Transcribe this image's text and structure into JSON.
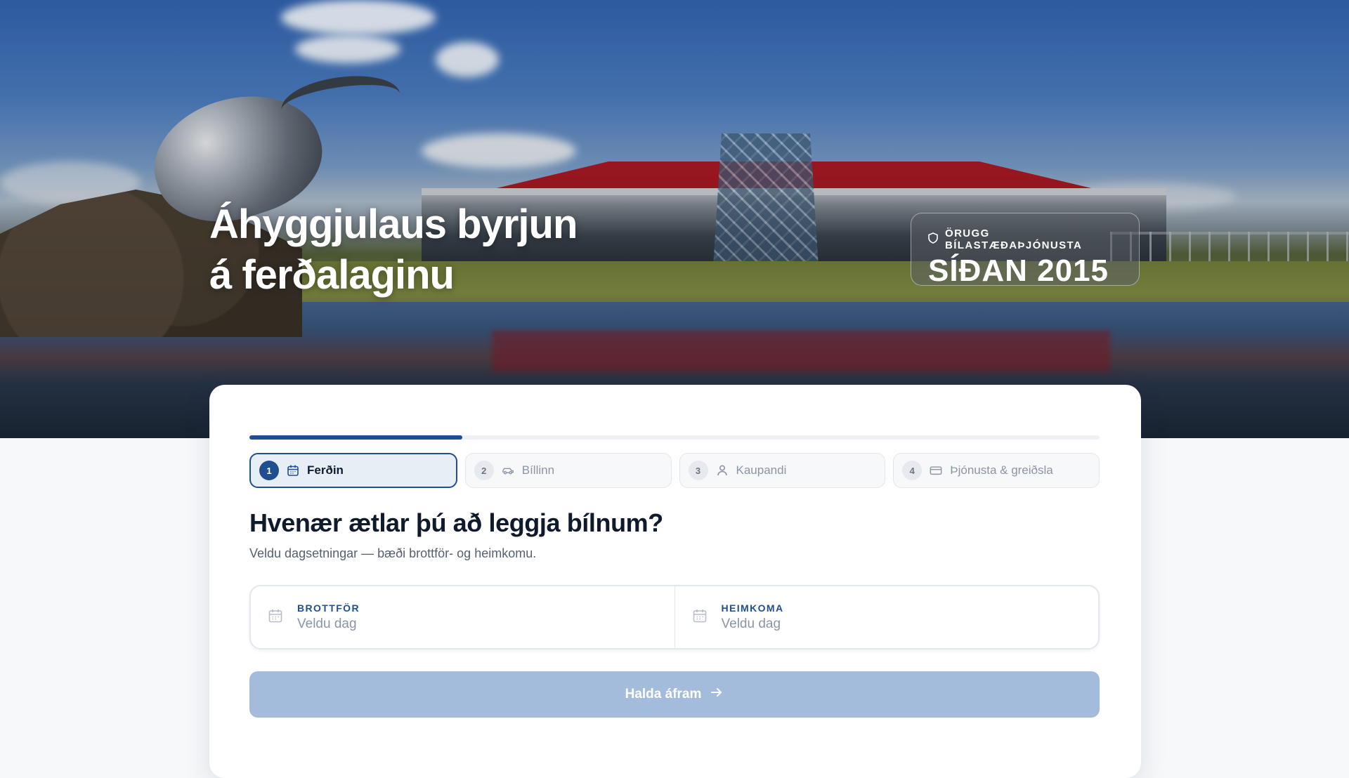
{
  "hero": {
    "title_line1": "Áhyggjulaus byrjun",
    "title_line2": "á ferðalaginu",
    "badge_top": "ÖRUGG BÍLASTÆÐAÞJÓNUSTA",
    "badge_big": "SÍÐAN 2015",
    "badge_icon": "shield-icon"
  },
  "progress": {
    "current_step": 1,
    "total_steps": 4,
    "fraction": 0.25
  },
  "steps": [
    {
      "number": "1",
      "label": "Ferðin",
      "icon": "calendar-icon",
      "active": true
    },
    {
      "number": "2",
      "label": "Bíllinn",
      "icon": "car-icon",
      "active": false
    },
    {
      "number": "3",
      "label": "Kaupandi",
      "icon": "user-icon",
      "active": false
    },
    {
      "number": "4",
      "label": "Þjónusta & greiðsla",
      "icon": "credit-card-icon",
      "active": false
    }
  ],
  "form": {
    "question": "Hvenær ætlar þú að leggja bílnum?",
    "subtitle": "Veldu dagsetningar — bæði brottför- og heimkomu.",
    "departure": {
      "label": "BROTTFÖR",
      "placeholder": "Veldu dag",
      "icon": "calendar-icon"
    },
    "return": {
      "label": "HEIMKOMA",
      "placeholder": "Veldu dag",
      "icon": "calendar-icon"
    },
    "continue_label": "Halda áfram",
    "continue_icon": "arrow-right-icon"
  },
  "colors": {
    "accent": "#1f4f8f",
    "button_disabled": "#a4bcdb",
    "text_dark": "#0f1a2c",
    "muted": "#8b95a5"
  }
}
